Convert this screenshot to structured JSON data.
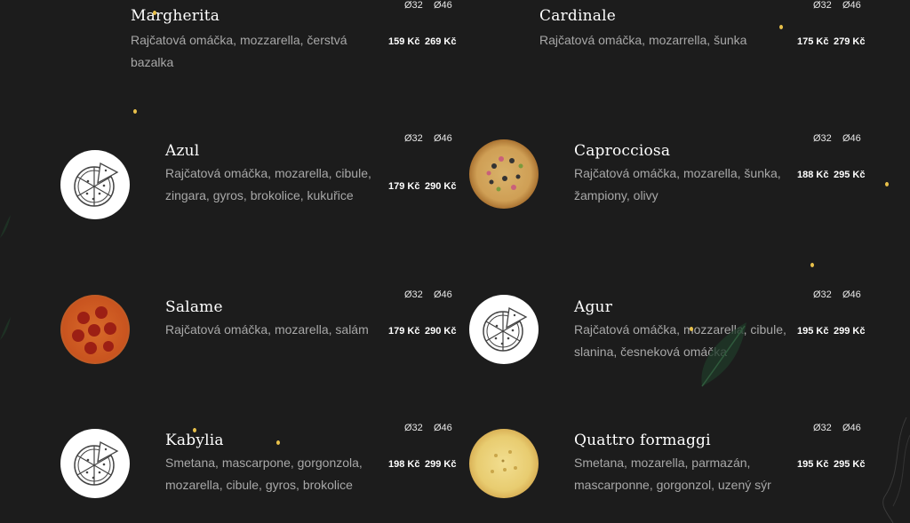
{
  "menu": {
    "items": [
      {
        "name": "Margherita",
        "desc": "Rajčatová omáčka, mozzarella, čerstvá bazalka",
        "size_small": "Ø32",
        "size_large": "Ø46",
        "price_small": "159 Kč",
        "price_large": "269 Kč",
        "image": "none"
      },
      {
        "name": "Cardinale",
        "desc": "Rajčatová omáčka, mozarrella, šunka",
        "size_small": "Ø32",
        "size_large": "Ø46",
        "price_small": "175 Kč",
        "price_large": "279 Kč",
        "image": "none"
      },
      {
        "name": "Azul",
        "desc": "Rajčatová omáčka, mozarella, cibule, zingara, gyros, brokolice, kukuřice",
        "size_small": "Ø32",
        "size_large": "Ø46",
        "price_small": "179 Kč",
        "price_large": "290 Kč",
        "image": "pizza-placeholder-icon"
      },
      {
        "name": "Caprocciosa",
        "desc": "Rajčatová omáčka, mozarella, šunka, žampiony, olivy",
        "size_small": "Ø32",
        "size_large": "Ø46",
        "price_small": "188 Kč",
        "price_large": "295 Kč",
        "image": "capricciosa-photo"
      },
      {
        "name": "Salame",
        "desc": "Rajčatová omáčka, mozarella, salám",
        "size_small": "Ø32",
        "size_large": "Ø46",
        "price_small": "179 Kč",
        "price_large": "290 Kč",
        "image": "salame-photo"
      },
      {
        "name": "Agur",
        "desc": "Rajčatová omáčka, mozzarella, cibule, slanina, česneková omáčka",
        "size_small": "Ø32",
        "size_large": "Ø46",
        "price_small": "195 Kč",
        "price_large": "299 Kč",
        "image": "pizza-placeholder-icon"
      },
      {
        "name": "Kabylia",
        "desc": "Smetana, mascarpone, gorgonzola, mozarella, cibule, gyros, brokolice",
        "size_small": "Ø32",
        "size_large": "Ø46",
        "price_small": "198 Kč",
        "price_large": "299 Kč",
        "image": "pizza-placeholder-icon"
      },
      {
        "name": "Quattro formaggi",
        "desc": "Smetana, mozarella, parmazán, mascarponne, gorgonzol, uzený sýr",
        "size_small": "Ø32",
        "size_large": "Ø46",
        "price_small": "195 Kč",
        "price_large": "295 Kč",
        "image": "quattro-formaggi-photo"
      }
    ]
  },
  "colors": {
    "background": "#1c1c1c",
    "description": "#a8a8a8",
    "accent_spark": "#e8c04a"
  }
}
